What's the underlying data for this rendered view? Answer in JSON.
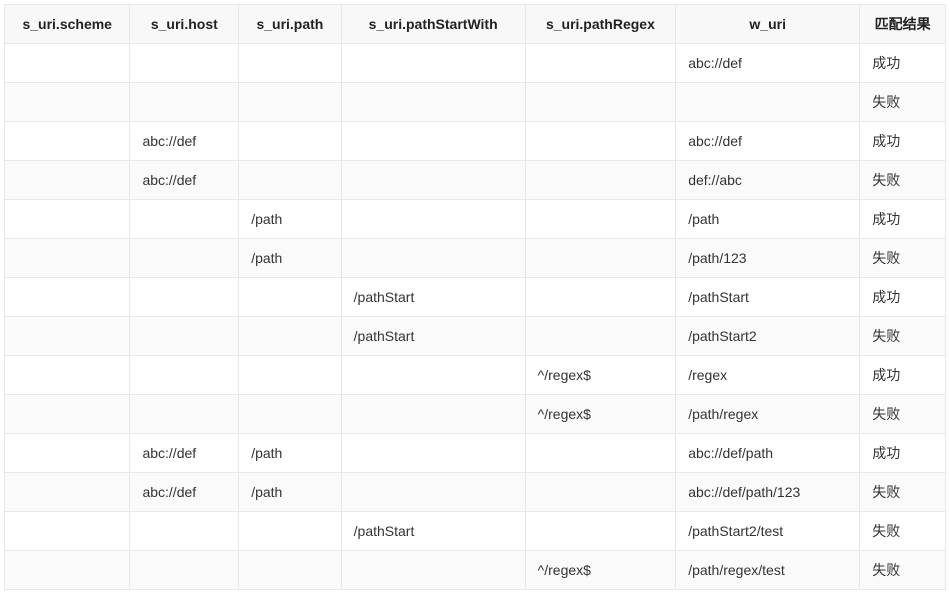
{
  "headers": {
    "scheme": "s_uri.scheme",
    "host": "s_uri.host",
    "path": "s_uri.path",
    "pathStartWith": "s_uri.pathStartWith",
    "pathRegex": "s_uri.pathRegex",
    "w_uri": "w_uri",
    "result": "匹配结果"
  },
  "rows": [
    {
      "scheme": "",
      "host": "",
      "path": "",
      "pathStartWith": "",
      "pathRegex": "",
      "w_uri": "abc://def",
      "result": "成功"
    },
    {
      "scheme": "",
      "host": "",
      "path": "",
      "pathStartWith": "",
      "pathRegex": "",
      "w_uri": "",
      "result": "失败"
    },
    {
      "scheme": "",
      "host": "abc://def",
      "path": "",
      "pathStartWith": "",
      "pathRegex": "",
      "w_uri": "abc://def",
      "result": "成功"
    },
    {
      "scheme": "",
      "host": "abc://def",
      "path": "",
      "pathStartWith": "",
      "pathRegex": "",
      "w_uri": "def://abc",
      "result": "失败"
    },
    {
      "scheme": "",
      "host": "",
      "path": "/path",
      "pathStartWith": "",
      "pathRegex": "",
      "w_uri": "/path",
      "result": "成功"
    },
    {
      "scheme": "",
      "host": "",
      "path": "/path",
      "pathStartWith": "",
      "pathRegex": "",
      "w_uri": "/path/123",
      "result": "失败"
    },
    {
      "scheme": "",
      "host": "",
      "path": "",
      "pathStartWith": "/pathStart",
      "pathRegex": "",
      "w_uri": "/pathStart",
      "result": "成功"
    },
    {
      "scheme": "",
      "host": "",
      "path": "",
      "pathStartWith": "/pathStart",
      "pathRegex": "",
      "w_uri": "/pathStart2",
      "result": "失败"
    },
    {
      "scheme": "",
      "host": "",
      "path": "",
      "pathStartWith": "",
      "pathRegex": "^/regex$",
      "w_uri": "/regex",
      "result": "成功"
    },
    {
      "scheme": "",
      "host": "",
      "path": "",
      "pathStartWith": "",
      "pathRegex": "^/regex$",
      "w_uri": "/path/regex",
      "result": "失败"
    },
    {
      "scheme": "",
      "host": "abc://def",
      "path": "/path",
      "pathStartWith": "",
      "pathRegex": "",
      "w_uri": "abc://def/path",
      "result": "成功"
    },
    {
      "scheme": "",
      "host": "abc://def",
      "path": "/path",
      "pathStartWith": "",
      "pathRegex": "",
      "w_uri": "abc://def/path/123",
      "result": "失败"
    },
    {
      "scheme": "",
      "host": "",
      "path": "",
      "pathStartWith": "/pathStart",
      "pathRegex": "",
      "w_uri": "/pathStart2/test",
      "result": "失败"
    },
    {
      "scheme": "",
      "host": "",
      "path": "",
      "pathStartWith": "",
      "pathRegex": "^/regex$",
      "w_uri": "/path/regex/test",
      "result": "失败"
    }
  ]
}
